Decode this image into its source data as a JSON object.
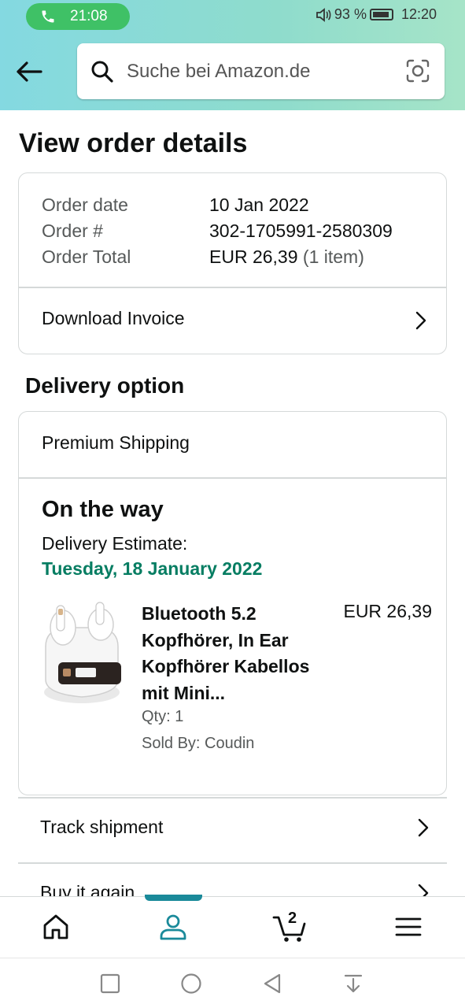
{
  "status_bar": {
    "call_time": "21:08",
    "volume_icon": "speaker-icon",
    "battery_percent": "93 %",
    "clock": "12:20"
  },
  "header": {
    "search_placeholder": "Suche bei Amazon.de",
    "background_colors": [
      "#84d9e1",
      "#a6e4c8"
    ]
  },
  "page": {
    "title": "View order details"
  },
  "order_summary": {
    "rows": [
      {
        "label": "Order date",
        "value": "10 Jan 2022"
      },
      {
        "label": "Order #",
        "value": "302-1705991-2580309"
      },
      {
        "label": "Order Total",
        "value": "EUR 26,39",
        "extra": "(1 item)"
      }
    ],
    "download_invoice": "Download Invoice"
  },
  "delivery": {
    "section_title": "Delivery option",
    "shipping_method": "Premium Shipping",
    "status": "On the way",
    "estimate_label": "Delivery Estimate:",
    "estimate_date": "Tuesday, 18 January 2022",
    "estimate_color": "#067d62",
    "item": {
      "title": "Bluetooth 5.2 Kopfhörer, In Ear Kopfhörer Kabellos mit Mini...",
      "price": "EUR 26,39",
      "qty": "Qty: 1",
      "seller": "Sold By: Coudin"
    }
  },
  "actions": {
    "track_shipment": "Track shipment",
    "buy_again": "Buy it again"
  },
  "bottom_nav": {
    "cart_count": "2",
    "active_tab": "account",
    "accent_color": "#1a8a9a"
  }
}
